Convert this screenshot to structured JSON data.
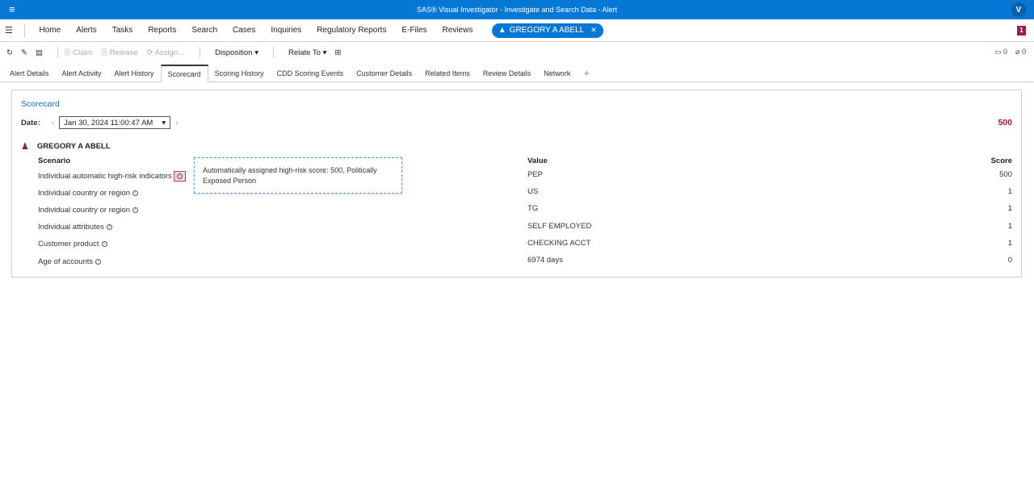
{
  "titlebar": {
    "title": "SAS® Visual Investigator - Investigate and Search Data - Alert",
    "avatar": "V"
  },
  "nav": {
    "items": [
      "Home",
      "Alerts",
      "Tasks",
      "Reports",
      "Search",
      "Cases",
      "Inquiries",
      "Regulatory Reports",
      "E-Files",
      "Reviews"
    ],
    "active_pill": "GREGORY A ABELL",
    "notification_count": "1"
  },
  "toolbar": {
    "claim": "Claim",
    "release": "Release",
    "assign": "Assign...",
    "disposition": "Disposition",
    "relate_to": "Relate To",
    "comments_count": "0",
    "attachments_count": "0"
  },
  "tabs": [
    "Alert Details",
    "Alert Activity",
    "Alert History",
    "Scorecard",
    "Scoring History",
    "CDD Scoring Events",
    "Customer Details",
    "Related Items",
    "Review Details",
    "Network"
  ],
  "active_tab": "Scorecard",
  "scorecard": {
    "title": "Scorecard",
    "date_label": "Date:",
    "date_value": "Jan 30, 2024 11:00:47 AM",
    "total_score": "500",
    "person": "GREGORY A ABELL",
    "headers": {
      "scenario": "Scenario",
      "value": "Value",
      "score": "Score"
    },
    "rows": [
      {
        "scenario": "Individual automatic high-risk indicators",
        "value": "PEP",
        "score": "500"
      },
      {
        "scenario": "Individual country or region",
        "value": "US",
        "score": "1"
      },
      {
        "scenario": "Individual country or region",
        "value": "TG",
        "score": "1"
      },
      {
        "scenario": "Individual attributes",
        "value": "SELF EMPLOYED",
        "score": "1"
      },
      {
        "scenario": "Customer product",
        "value": "CHECKING ACCT",
        "score": "1"
      },
      {
        "scenario": "Age of accounts",
        "value": "6974 days",
        "score": "0"
      }
    ],
    "tooltip": "Automatically assigned high-risk score: 500, Politically Exposed Person"
  }
}
